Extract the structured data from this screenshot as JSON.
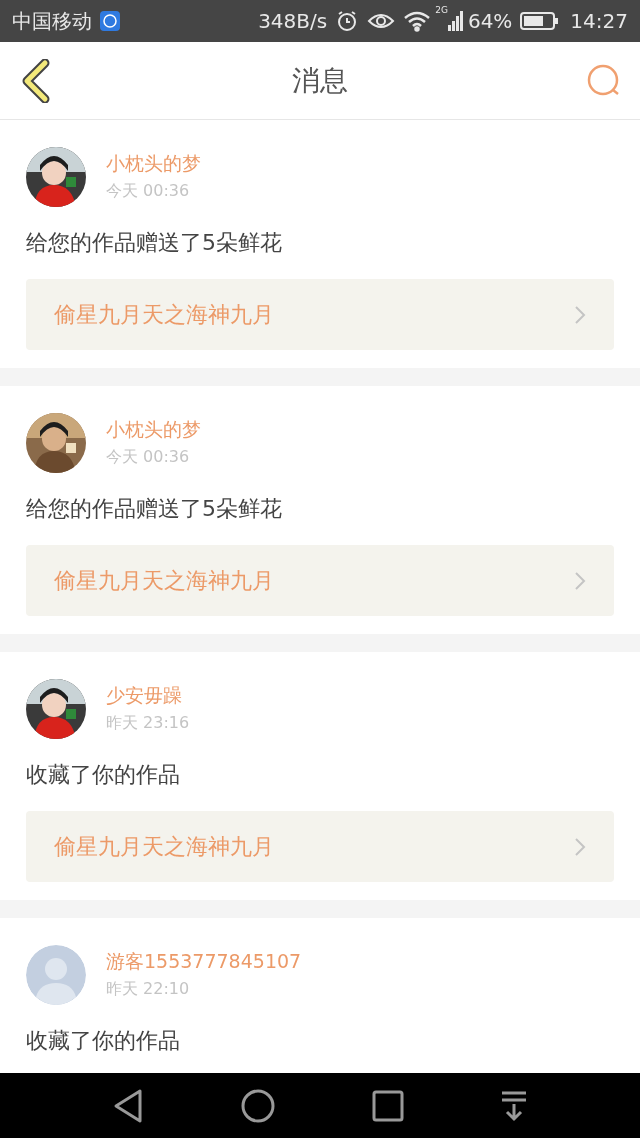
{
  "status_bar": {
    "carrier": "中国移动",
    "speed": "348B/s",
    "network": "2G",
    "battery": "64%",
    "time": "14:27"
  },
  "header": {
    "title": "消息"
  },
  "messages": [
    {
      "name": "小枕头的梦",
      "time": "今天 00:36",
      "text": "给您的作品赠送了5朵鲜花",
      "work": "偷星九月天之海神九月"
    },
    {
      "name": "小枕头的梦",
      "time": "今天 00:36",
      "text": "给您的作品赠送了5朵鲜花",
      "work": "偷星九月天之海神九月"
    },
    {
      "name": "少安毋躁",
      "time": "昨天 23:16",
      "text": "收藏了你的作品",
      "work": "偷星九月天之海神九月"
    },
    {
      "avatar": {
        "kind": "default"
      },
      "name": "游客1553777845107",
      "time": "昨天 22:10",
      "text": "收藏了你的作品"
    }
  ]
}
